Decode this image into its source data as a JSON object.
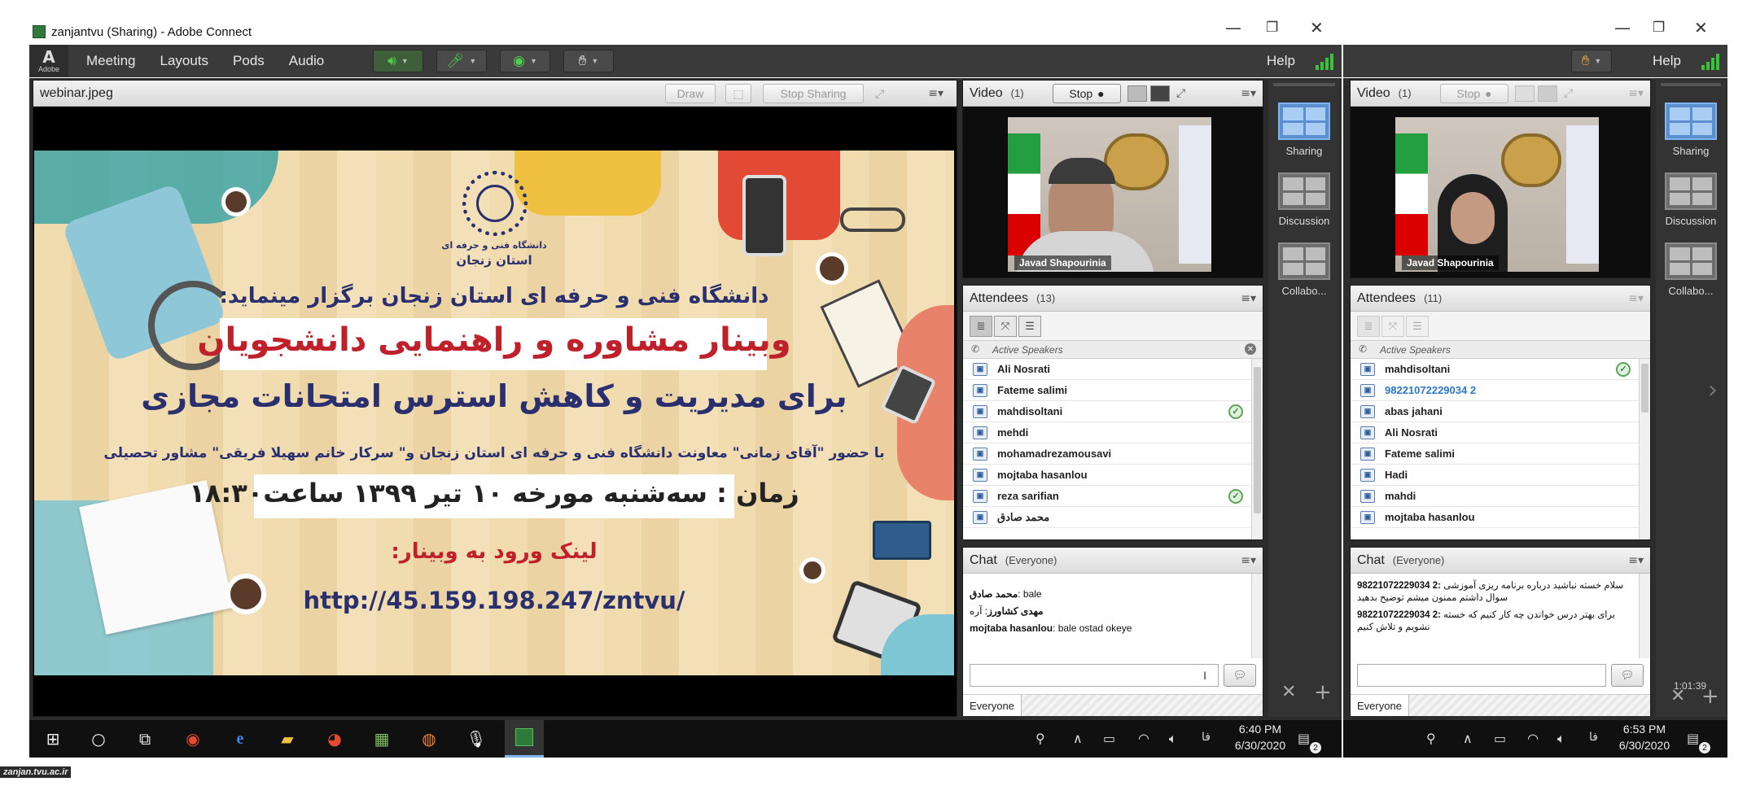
{
  "window": {
    "title": "zanjantvu (Sharing) - Adobe Connect",
    "minimize": "—",
    "restore": "❐",
    "close": "✕"
  },
  "menu": {
    "logo": "Adobe",
    "items": [
      "Meeting",
      "Layouts",
      "Pods",
      "Audio"
    ],
    "help": "Help"
  },
  "share_pod": {
    "title": "webinar.jpeg",
    "draw_label": "Draw",
    "stop_sharing_label": "Stop Sharing"
  },
  "slide": {
    "logo_caption_1": "دانشگاه فنی و حرفه ای",
    "logo_caption_2": "استان زنجان",
    "line1": "دانشگاه فنی و حرفه ای استان زنجان برگزار مینماید:",
    "line2": "وبینار مشاوره و راهنمایی دانشجویان",
    "line3": "برای مدیریت و کاهش استرس امتحانات مجازی",
    "line4": "با حضور \"آقای زمانی\" معاونت دانشگاه فنی و حرفه ای استان زنجان و\" سرکار خانم سهیلا فریقی\" مشاور تحصیلی",
    "line5": "زمان : سه‌شنبه مورخه ۱۰ تیر ۱۳۹۹ ساعت۱۸:۳۰",
    "line6": "لینک ورود به وبینار:",
    "url": "http://45.159.198.247/zntvu/"
  },
  "left_video": {
    "title": "Video",
    "count": "(1)",
    "stop_label": "Stop",
    "name": "Javad Shapourinia"
  },
  "left_attendees": {
    "title": "Attendees",
    "count": "(13)",
    "section": "Active Speakers",
    "rows": [
      {
        "name": "Ali Nosrati",
        "check": false
      },
      {
        "name": "Fateme salimi",
        "check": false
      },
      {
        "name": "mahdisoltani",
        "check": true
      },
      {
        "name": "mehdi",
        "check": false
      },
      {
        "name": "mohamadrezamousavi",
        "check": false
      },
      {
        "name": "mojtaba hasanlou",
        "check": false
      },
      {
        "name": "reza sarifian",
        "check": true
      },
      {
        "name": "محمد صادق",
        "check": false
      }
    ]
  },
  "left_chat": {
    "title": "Chat",
    "scope": "(Everyone)",
    "messages": [
      {
        "from": "محمد صادق",
        "text": ": bale"
      },
      {
        "from": "مهدی کشاورز",
        "text": ": آره"
      },
      {
        "from": "mojtaba hasanlou",
        "text": ": bale ostad okeye"
      }
    ],
    "recipient": "Everyone"
  },
  "left_layouts": [
    {
      "label": "Sharing",
      "selected": true
    },
    {
      "label": "Discussion",
      "selected": false
    },
    {
      "label": "Collabo...",
      "selected": false
    }
  ],
  "right_video": {
    "title": "Video",
    "count": "(1)",
    "stop_label": "Stop",
    "name": "Javad Shapourinia"
  },
  "right_attendees": {
    "title": "Attendees",
    "count": "(11)",
    "section": "Active Speakers",
    "rows": [
      {
        "name": "mahdisoltani",
        "check": true,
        "blue": false
      },
      {
        "name": "98221072229034 2",
        "check": false,
        "blue": true
      },
      {
        "name": "abas jahani",
        "check": false,
        "blue": false
      },
      {
        "name": "Ali Nosrati",
        "check": false,
        "blue": false
      },
      {
        "name": "Fateme salimi",
        "check": false,
        "blue": false
      },
      {
        "name": "Hadi",
        "check": false,
        "blue": false
      },
      {
        "name": "mahdi",
        "check": false,
        "blue": false
      },
      {
        "name": "mojtaba hasanlou",
        "check": false,
        "blue": false
      }
    ]
  },
  "right_chat": {
    "title": "Chat",
    "scope": "(Everyone)",
    "messages": [
      {
        "from": "98221072229034 2:",
        "text": "سلام خسته نباشید درباره برنامه ریزی آموزشی سوال داشتم ممنون میشم توضیح بدهید"
      },
      {
        "from": "98221072229034 2:",
        "text": "برای بهتر درس خواندن چه کار کنیم که خسته نشویم و تلاش کنیم"
      }
    ],
    "recipient": "Everyone",
    "timer": "1:01:39"
  },
  "right_layouts": [
    {
      "label": "Sharing",
      "selected": true
    },
    {
      "label": "Discussion",
      "selected": false
    },
    {
      "label": "Collabo...",
      "selected": false
    }
  ],
  "taskbar_left": {
    "lang": "فا",
    "time": "6:40 PM",
    "date": "6/30/2020",
    "notif": "2"
  },
  "taskbar_right": {
    "lang": "فا",
    "time": "6:53 PM",
    "date": "6/30/2020",
    "notif": "2"
  },
  "watermark": "zanjan.tvu.ac.ir",
  "colors": {
    "menubar": "#3a3a3a",
    "app_bg": "#2c2c2c",
    "slide_red": "#c0202a",
    "slide_navy": "#2a2f6e",
    "active_check": "#5aa55a",
    "link_blue": "#2b78c8"
  }
}
